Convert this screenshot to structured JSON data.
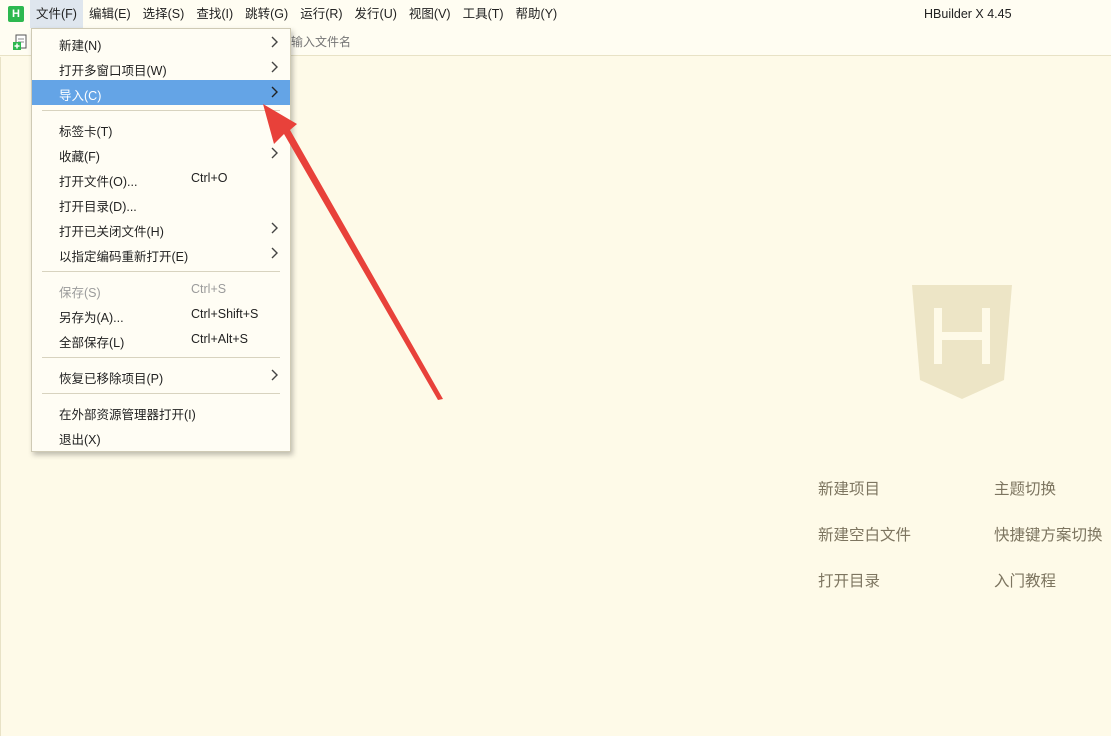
{
  "app": {
    "logo_letter": "H",
    "window_title": "HBuilder X 4.45"
  },
  "menubar": {
    "items": [
      {
        "label": "文件(F)"
      },
      {
        "label": "编辑(E)"
      },
      {
        "label": "选择(S)"
      },
      {
        "label": "查找(I)"
      },
      {
        "label": "跳转(G)"
      },
      {
        "label": "运行(R)"
      },
      {
        "label": "发行(U)"
      },
      {
        "label": "视图(V)"
      },
      {
        "label": "工具(T)"
      },
      {
        "label": "帮助(Y)"
      }
    ]
  },
  "toolbar": {
    "search_placeholder": "输入文件名"
  },
  "file_menu": {
    "items": [
      {
        "label": "新建(N)",
        "submenu": true
      },
      {
        "label": "打开多窗口项目(W)",
        "submenu": true
      },
      {
        "label": "导入(C)",
        "submenu": true,
        "highlighted": true
      },
      {
        "label": "标签卡(T)",
        "submenu": true
      },
      {
        "label": "收藏(F)",
        "submenu": true
      },
      {
        "label": "打开文件(O)...",
        "shortcut": "Ctrl+O"
      },
      {
        "label": "打开目录(D)..."
      },
      {
        "label": "打开已关闭文件(H)",
        "submenu": true
      },
      {
        "label": "以指定编码重新打开(E)",
        "submenu": true
      },
      {
        "label": "保存(S)",
        "shortcut": "Ctrl+S",
        "disabled": true
      },
      {
        "label": "另存为(A)...",
        "shortcut": "Ctrl+Shift+S"
      },
      {
        "label": "全部保存(L)",
        "shortcut": "Ctrl+Alt+S"
      },
      {
        "label": "恢复已移除项目(P)",
        "submenu": true
      },
      {
        "label": "在外部资源管理器打开(I)"
      },
      {
        "label": "退出(X)"
      }
    ]
  },
  "welcome": {
    "logo_letter": "H",
    "links": {
      "new_project": "新建项目",
      "theme_switch": "主题切换",
      "new_blank_file": "新建空白文件",
      "keymap_switch": "快捷键方案切换",
      "open_dir": "打开目录",
      "tutorial": "入门教程"
    }
  },
  "colors": {
    "background": "#fefae8",
    "menu_highlight": "#64a4e6",
    "annotation_arrow": "#e8413a",
    "logo_green": "#2db84f",
    "welcome_link": "#7d7560"
  }
}
